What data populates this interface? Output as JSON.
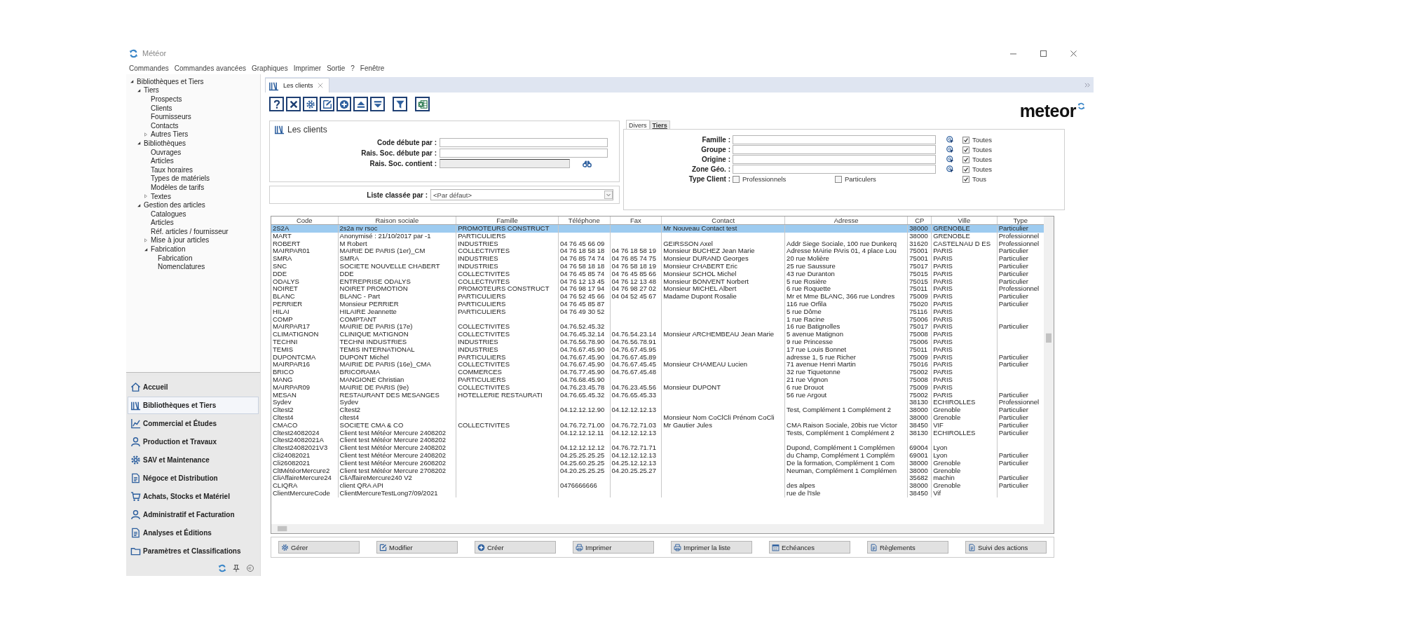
{
  "window": {
    "title": "Météor"
  },
  "menu": [
    "Commandes",
    "Commandes avancées",
    "Graphiques",
    "Imprimer",
    "Sortie",
    "?",
    "Fenêtre"
  ],
  "sidebar": {
    "tree": [
      {
        "label": "Bibliothèques et Tiers",
        "expanded": true,
        "children": [
          {
            "label": "Tiers",
            "expanded": true,
            "children": [
              {
                "label": "Prospects"
              },
              {
                "label": "Clients"
              },
              {
                "label": "Fournisseurs"
              },
              {
                "label": "Contacts"
              },
              {
                "label": "Autres Tiers",
                "expanded": false
              }
            ]
          },
          {
            "label": "Bibliothèques",
            "expanded": true,
            "children": [
              {
                "label": "Ouvrages"
              },
              {
                "label": "Articles"
              },
              {
                "label": "Taux horaires"
              },
              {
                "label": "Types de matériels"
              },
              {
                "label": "Modèles de tarifs"
              },
              {
                "label": "Textes",
                "expanded": false
              }
            ]
          },
          {
            "label": "Gestion des articles",
            "expanded": true,
            "children": [
              {
                "label": "Catalogues"
              },
              {
                "label": "Articles"
              },
              {
                "label": "Réf. articles / fournisseur"
              },
              {
                "label": "Mise à jour articles",
                "expanded": false
              },
              {
                "label": "Fabrication",
                "expanded": true,
                "children": [
                  {
                    "label": "Fabrication"
                  },
                  {
                    "label": "Nomenclatures"
                  }
                ]
              }
            ]
          }
        ]
      }
    ],
    "nav": [
      {
        "label": "Accueil",
        "selected": false
      },
      {
        "label": "Bibliothèques et Tiers",
        "selected": true
      },
      {
        "label": "Commercial et Études",
        "selected": false
      },
      {
        "label": "Production et Travaux",
        "selected": false
      },
      {
        "label": "SAV et Maintenance",
        "selected": false
      },
      {
        "label": "Négoce et Distribution",
        "selected": false
      },
      {
        "label": "Achats, Stocks et Matériel",
        "selected": false
      },
      {
        "label": "Administratif et Facturation",
        "selected": false
      },
      {
        "label": "Analyses et Éditions",
        "selected": false
      },
      {
        "label": "Paramètres et Classifications",
        "selected": false
      }
    ]
  },
  "document_tab": {
    "label": "Les clients"
  },
  "logo": "meteor",
  "search_panel": {
    "title": "Les clients",
    "fields": [
      {
        "label": "Code débute par :",
        "kind": "text"
      },
      {
        "label": "Rais. Soc. débute par :",
        "kind": "text"
      },
      {
        "label": "Rais. Soc. contient :",
        "kind": "search"
      }
    ],
    "sort": {
      "label": "Liste classée par :",
      "value": "<Par défaut>"
    }
  },
  "filter_panel": {
    "tabs": [
      {
        "label": "Divers",
        "selected": true
      },
      {
        "label": "Tiers",
        "selected": false
      }
    ],
    "fields": [
      {
        "label": "Famille :",
        "all_label": "Toutes",
        "all_checked": true
      },
      {
        "label": "Groupe :",
        "all_label": "Toutes",
        "all_checked": true
      },
      {
        "label": "Origine :",
        "all_label": "Toutes",
        "all_checked": true
      },
      {
        "label": "Zone Géo. :",
        "all_label": "Toutes",
        "all_checked": true
      }
    ],
    "type_client": {
      "label": "Type Client :",
      "options": [
        {
          "label": "Professionnels",
          "checked": false
        },
        {
          "label": "Particulers",
          "checked": false
        },
        {
          "label": "Tous",
          "checked": true
        }
      ]
    }
  },
  "table": {
    "columns": [
      "Code",
      "Raison sociale",
      "Famille",
      "Téléphone",
      "Fax",
      "Contact",
      "Adresse",
      "CP",
      "Ville",
      "Type"
    ],
    "rows": [
      {
        "selected": true,
        "cells": [
          "2S2A",
          "2s2a  nv rsoc",
          "PROMOTEURS CONSTRUCT",
          null,
          null,
          "Mr Nouveau Contact test",
          null,
          "38000",
          "GRENOBLE",
          "Particulier"
        ]
      },
      {
        "selected": false,
        "cells": [
          "MART",
          "Anonymisé : 21/10/2017 par -1",
          "PARTICULIERS",
          null,
          null,
          null,
          null,
          "38000",
          "GRENOBLE",
          "Professionnel"
        ]
      },
      {
        "selected": false,
        "cells": [
          "ROBERT",
          "M Robert",
          "INDUSTRIES",
          "04 76 45 66 09",
          null,
          "GEIRSSON Axel",
          "Addr Siege Sociale, 100 rue Dunkerq",
          "31620",
          "CASTELNAU D ES",
          "Professionnel"
        ]
      },
      {
        "selected": false,
        "cells": [
          "MAIRPAR01",
          "MAIRIE DE PARIS (1er)_CM",
          "COLLECTIVITES",
          "04 76 18 58 18",
          "04 76 18 58 19",
          "Monsieur BUCHEZ Jean Marie",
          "Adresse MAirie PAris 01, 4 place Lou",
          "75001",
          "PARIS",
          "Particulier"
        ]
      },
      {
        "selected": false,
        "cells": [
          "SMRA",
          "SMRA",
          "INDUSTRIES",
          "04 76 85 74 74",
          "04 76 85 74 75",
          "Monsieur DURAND Georges",
          "20 rue Molière",
          "75001",
          "PARIS",
          "Particulier"
        ]
      },
      {
        "selected": false,
        "cells": [
          "SNC",
          "SOCIETE NOUVELLE CHABERT",
          "INDUSTRIES",
          "04 76 58 18 18",
          "04 76 58 18 19",
          "Monsieur CHABERT Eric",
          "25 rue Saussure",
          "75017",
          "PARIS",
          "Particulier"
        ]
      },
      {
        "selected": false,
        "cells": [
          "DDE",
          "DDE",
          "COLLECTIVITES",
          "04 76 45 85 74",
          "04 76 45 85 66",
          "Monsieur SCHOL Michel",
          "43 rue Duranton",
          "75015",
          "PARIS",
          "Particulier"
        ]
      },
      {
        "selected": false,
        "cells": [
          "ODALYS",
          "ENTREPRISE ODALYS",
          "COLLECTIVITES",
          "04 76 12 13 45",
          "04 76 12 13 48",
          "Monsieur BONVENT Norbert",
          "5 rue Rosière",
          "75015",
          "PARIS",
          "Particulier"
        ]
      },
      {
        "selected": false,
        "cells": [
          "NOIRET",
          "NOIRET PROMOTION",
          "PROMOTEURS CONSTRUCT",
          "04 76 98 17 94",
          "04 76 98 27 02",
          "Monsieur MICHEL Albert",
          "6 rue Roquette",
          "75011",
          "PARIS",
          "Professionnel"
        ]
      },
      {
        "selected": false,
        "cells": [
          "BLANC",
          "BLANC - Part",
          "PARTICULIERS",
          "04 76 52 45 66",
          "04 04 52 45 67",
          "Madame Dupont Rosalie",
          "Mr et Mme BLANC, 366 rue Londres",
          "75009",
          "PARIS",
          "Particulier"
        ]
      },
      {
        "selected": false,
        "cells": [
          "PERRIER",
          "Monsieur PERRIER",
          "PARTICULIERS",
          "04 76 45 85 87",
          null,
          null,
          "116 rue Orfila",
          "75020",
          "PARIS",
          "Particulier"
        ]
      },
      {
        "selected": false,
        "cells": [
          "HILAI",
          "HILAIRE Jeannette",
          "PARTICULIERS",
          "04 76 49 30 52",
          null,
          null,
          "5 rue Dôme",
          "75116",
          "PARIS",
          null
        ]
      },
      {
        "selected": false,
        "cells": [
          "COMP",
          "COMPTANT",
          null,
          null,
          null,
          null,
          "1 rue Racine",
          "75006",
          "PARIS",
          null
        ]
      },
      {
        "selected": false,
        "cells": [
          "MAIRPAR17",
          "MAIRIE DE PARIS (17e)",
          "COLLECTIVITES",
          "04.76.52.45.32",
          null,
          null,
          "16 rue Batignolles",
          "75017",
          "PARIS",
          "Particulier"
        ]
      },
      {
        "selected": false,
        "cells": [
          "CLIMATIGNON",
          "CLINIQUE MATIGNON",
          "COLLECTIVITES",
          "04.76.45.32.14",
          "04.76.54.23.14",
          "Monsieur ARCHEMBEAU Jean Marie",
          "5 avenue Matignon",
          "75008",
          "PARIS",
          null
        ]
      },
      {
        "selected": false,
        "cells": [
          "TECHNI",
          "TECHNI INDUSTRIES",
          "INDUSTRIES",
          "04.76.56.78.90",
          "04.76.56.78.91",
          null,
          "9 rue Princesse",
          "75006",
          "PARIS",
          null
        ]
      },
      {
        "selected": false,
        "cells": [
          "TEMIS",
          "TEMIS INTERNATIONAL",
          "INDUSTRIES",
          "04.76.67.45.90",
          "04.76.67.45.95",
          null,
          "17 rue Louis Bonnet",
          "75011",
          "PARIS",
          null
        ]
      },
      {
        "selected": false,
        "cells": [
          "DUPONTCMA",
          "DUPONT Michel",
          "PARTICULIERS",
          "04.76.67.45.90",
          "04.76.67.45.89",
          null,
          "adresse 1, 5 rue Richer",
          "75009",
          "PARIS",
          "Particulier"
        ]
      },
      {
        "selected": false,
        "cells": [
          "MAIRPAR16",
          "MAIRIE DE PARIS (16e)_CMA",
          "COLLECTIVITES",
          "04.76.67.45.90",
          "04.76.67.45.45",
          "Monsieur CHAMEAU Lucien",
          "71 avenue Henri Martin",
          "75016",
          "PARIS",
          "Particulier"
        ]
      },
      {
        "selected": false,
        "cells": [
          "BRICO",
          "BRICORAMA",
          "COMMERCES",
          "04.76.77.45.90",
          "04.76.67.45.48",
          null,
          "32 rue Tiquetonne",
          "75002",
          "PARIS",
          null
        ]
      },
      {
        "selected": false,
        "cells": [
          "MANG",
          "MANGIONE Christian",
          "PARTICULIERS",
          "04.76.68.45.90",
          null,
          null,
          "21 rue Vignon",
          "75008",
          "PARIS",
          null
        ]
      },
      {
        "selected": false,
        "cells": [
          "MAIRPAR09",
          "MAIRIE DE PARIS (9e)",
          "COLLECTIVITES",
          "04.76.23.45.78",
          "04.76.23.45.56",
          "Monsieur DUPONT",
          "6 rue Drouot",
          "75009",
          "PARIS",
          null
        ]
      },
      {
        "selected": false,
        "cells": [
          "MESAN",
          "RESTAURANT DES MESANGES",
          "HOTELLERIE RESTAURATI",
          "04.76.65.45.32",
          "04.76.65.45.33",
          null,
          "56 rue Argout",
          "75002",
          "PARIS",
          "Particulier"
        ]
      },
      {
        "selected": false,
        "cells": [
          "Sydev",
          "Sydev",
          null,
          null,
          null,
          null,
          null,
          "38130",
          "ECHIROLLES",
          "Professionnel"
        ]
      },
      {
        "selected": false,
        "cells": [
          "Cltest2",
          "Cltest2",
          null,
          "04.12.12.12.90",
          "04.12.12.12.13",
          null,
          "Test, Complément 1 Complément 2",
          "38000",
          "Grenoble",
          "Particulier"
        ]
      },
      {
        "selected": false,
        "cells": [
          "Cltest4",
          "cltest4",
          null,
          null,
          null,
          "Monsieur Nom CoClCli Prénom CoCli",
          null,
          "38000",
          "Grenoble",
          "Particulier"
        ]
      },
      {
        "selected": false,
        "cells": [
          "CMACO",
          "SOCIETE CMA & CO",
          "COLLECTIVITES",
          "04.76.72.71.00",
          "04.76.72.71.03",
          "Mr Gautier Jules",
          "CMA Raison Sociale, 20bis rue Victor",
          "38450",
          "VIF",
          "Particulier"
        ]
      },
      {
        "selected": false,
        "cells": [
          "Cltest24082024",
          "Client test Météor Mercure 2408202",
          null,
          "04.12.12.12.11",
          "04.12.12.12.13",
          null,
          "Tests, Complément 1 Complément 2",
          "38130",
          "ECHIROLLES",
          "Particulier"
        ]
      },
      {
        "selected": false,
        "cells": [
          "Cltest24082021A",
          "Client test Météor Mercure 2408202",
          null,
          null,
          null,
          null,
          null,
          null,
          null,
          null
        ]
      },
      {
        "selected": false,
        "cells": [
          "Cltest24082021V3",
          "Client test Météor Mercure 2408202",
          null,
          "04.12.12.12.12",
          "04.76.72.71.71",
          null,
          "Dupond, Complément 1 Complémen",
          "69004",
          "Lyon",
          null
        ]
      },
      {
        "selected": false,
        "cells": [
          "Cli24082021",
          "Client test Météor Mercure 2408202",
          null,
          "04.25.25.25.25",
          "04.12.12.12.13",
          null,
          "du Champ, Complément 1 Complém",
          "69001",
          "Lyon",
          "Particulier"
        ]
      },
      {
        "selected": false,
        "cells": [
          "Cli26082021",
          "Client test Météor Mercure 2608202",
          null,
          "04.25.60.25.25",
          "04.25.12.12.13",
          null,
          "De la formation, Complément 1 Com",
          "38000",
          "Grenoble",
          "Particulier"
        ]
      },
      {
        "selected": false,
        "cells": [
          "CltMétéorMercure2",
          "Client test Météor Mercure 2708202",
          null,
          "04.20.25.25.25",
          "04.20.25.25.27",
          null,
          "Neuman, Complément 1 Complémen",
          "38000",
          "Grenoble",
          null
        ]
      },
      {
        "selected": false,
        "cells": [
          "CliAffaireMercure24",
          "CliAffaireMercure240 V2",
          null,
          null,
          null,
          null,
          null,
          "35682",
          "machin",
          "Particulier"
        ]
      },
      {
        "selected": false,
        "cells": [
          "CLIQRA",
          "client QRA API",
          null,
          "0476666666",
          null,
          null,
          "des alpes",
          "38000",
          "Grenoble",
          "Particulier"
        ]
      },
      {
        "selected": false,
        "cells": [
          "ClientMercureCode",
          "ClientMercureTestLong7/09/2021",
          null,
          null,
          null,
          null,
          "rue de l'Isle",
          "38450",
          "Vif",
          null
        ]
      }
    ]
  },
  "actions": [
    "Gérer",
    "Modifier",
    "Créer",
    "Imprimer",
    "Imprimer la liste",
    "Echéances",
    "Règlements",
    "Suivi des actions"
  ]
}
